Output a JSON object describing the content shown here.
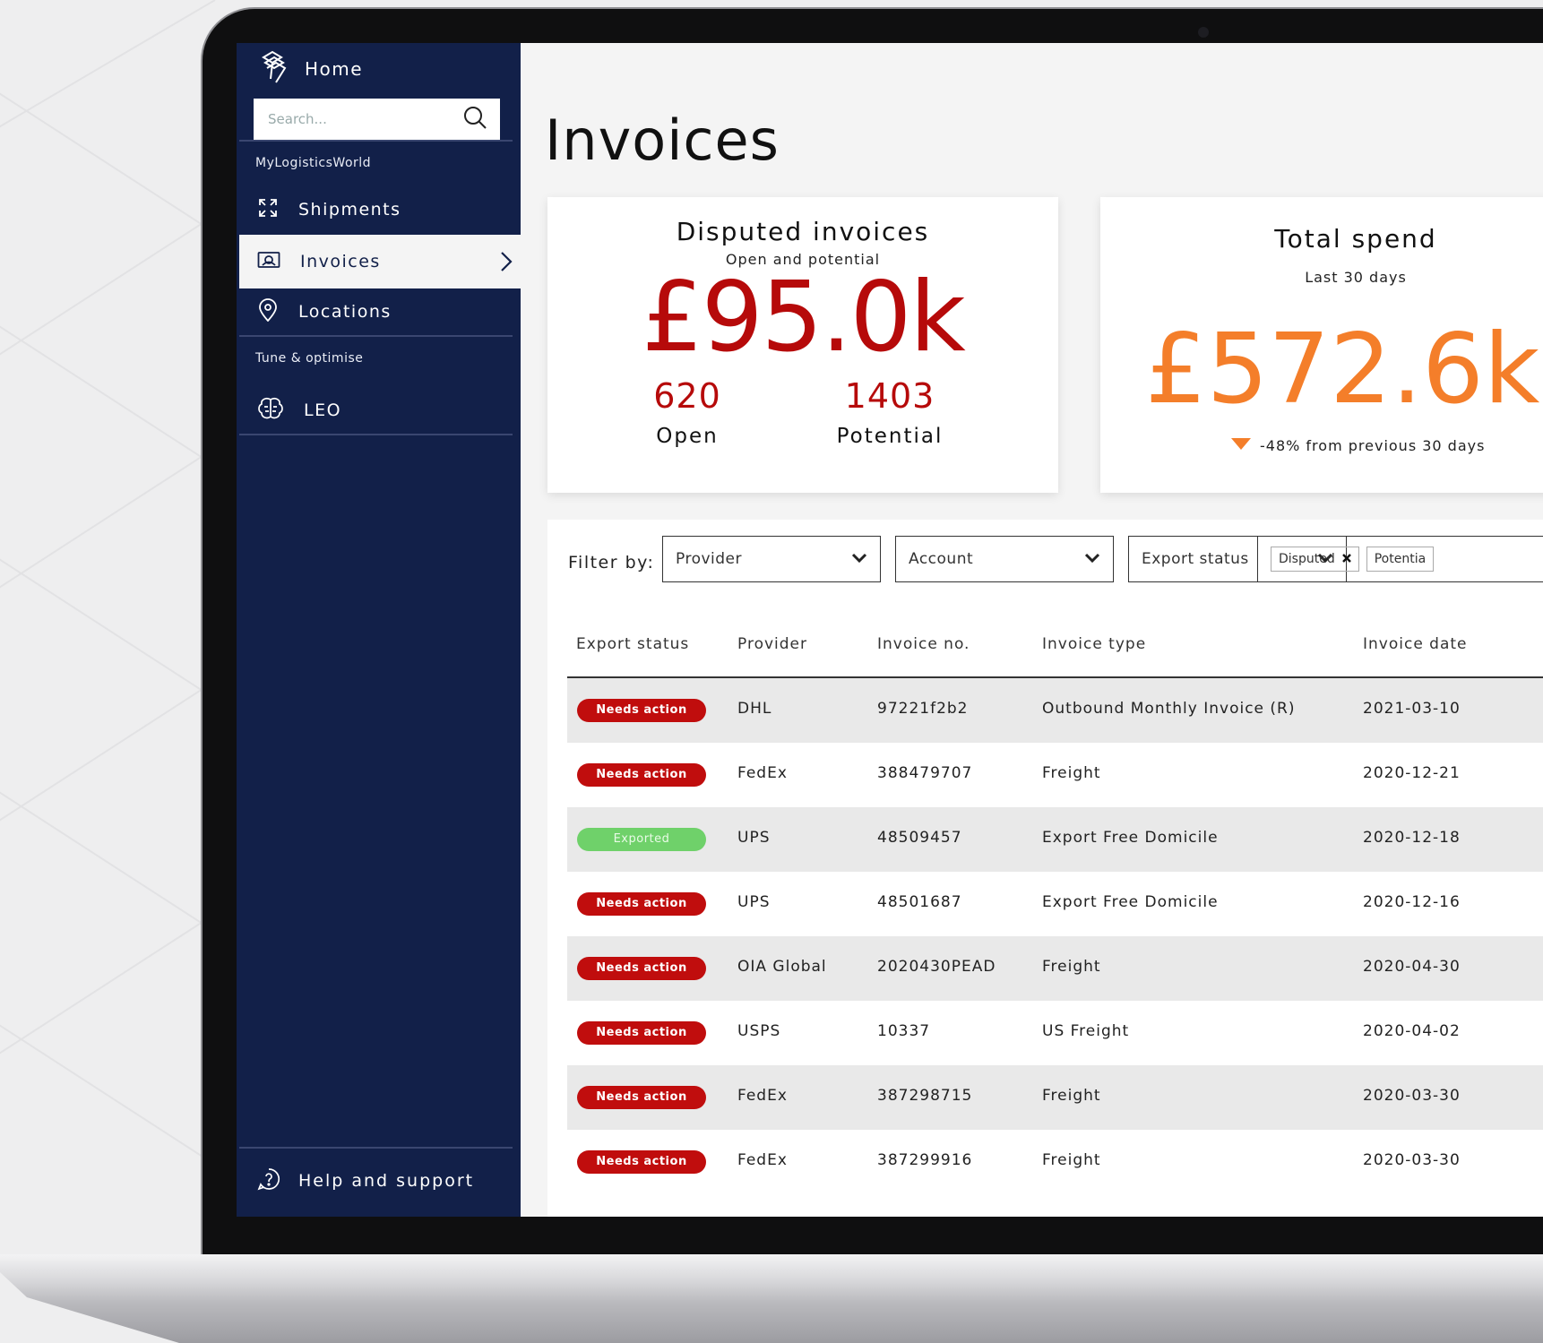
{
  "sidebar": {
    "home_label": "Home",
    "search_placeholder": "Search...",
    "section_1": "MyLogisticsWorld",
    "items": [
      {
        "label": "Shipments",
        "icon": "expand-icon"
      },
      {
        "label": "Invoices",
        "icon": "invoice-icon",
        "active": true
      },
      {
        "label": "Locations",
        "icon": "location-pin-icon"
      }
    ],
    "section_2": "Tune & optimise",
    "items_2": [
      {
        "label": "LEO",
        "icon": "brain-icon"
      }
    ],
    "help_label": "Help and support"
  },
  "main": {
    "title": "Invoices",
    "disputed": {
      "title": "Disputed invoices",
      "subtitle": "Open and potential",
      "amount": "£95.0k",
      "open_count": "620",
      "open_label": "Open",
      "potential_count": "1403",
      "potential_label": "Potential"
    },
    "spend": {
      "title": "Total spend",
      "subtitle": "Last 30 days",
      "amount": "£572.6k",
      "change": "-48% from previous 30 days"
    },
    "filters": {
      "label": "Filter by:",
      "provider": "Provider",
      "account": "Account",
      "export_status": "Export status",
      "chips": [
        "Disputed",
        "Potentia"
      ]
    },
    "table": {
      "headers": [
        "Export status",
        "Provider",
        "Invoice no.",
        "Invoice type",
        "Invoice date"
      ],
      "rows": [
        {
          "status": "Needs action",
          "provider": "DHL",
          "invoice_no": "97221f2b2",
          "type": "Outbound Monthly Invoice (R)",
          "date": "2021-03-10"
        },
        {
          "status": "Needs action",
          "provider": "FedEx",
          "invoice_no": "388479707",
          "type": "Freight",
          "date": "2020-12-21"
        },
        {
          "status": "Exported",
          "provider": "UPS",
          "invoice_no": "48509457",
          "type": "Export Free Domicile",
          "date": "2020-12-18"
        },
        {
          "status": "Needs action",
          "provider": "UPS",
          "invoice_no": "48501687",
          "type": "Export Free Domicile",
          "date": "2020-12-16"
        },
        {
          "status": "Needs action",
          "provider": "OIA Global",
          "invoice_no": "2020430PEAD",
          "type": "Freight",
          "date": "2020-04-30"
        },
        {
          "status": "Needs action",
          "provider": "USPS",
          "invoice_no": "10337",
          "type": "US Freight",
          "date": "2020-04-02"
        },
        {
          "status": "Needs action",
          "provider": "FedEx",
          "invoice_no": "387298715",
          "type": "Freight",
          "date": "2020-03-30"
        },
        {
          "status": "Needs action",
          "provider": "FedEx",
          "invoice_no": "387299916",
          "type": "Freight",
          "date": "2020-03-30"
        }
      ]
    }
  },
  "colors": {
    "sidebar_bg": "#122049",
    "accent_red": "#b60a0a",
    "accent_orange": "#f47e2a",
    "status_needs": "#c00d0d",
    "status_exported": "#6fd16a"
  }
}
